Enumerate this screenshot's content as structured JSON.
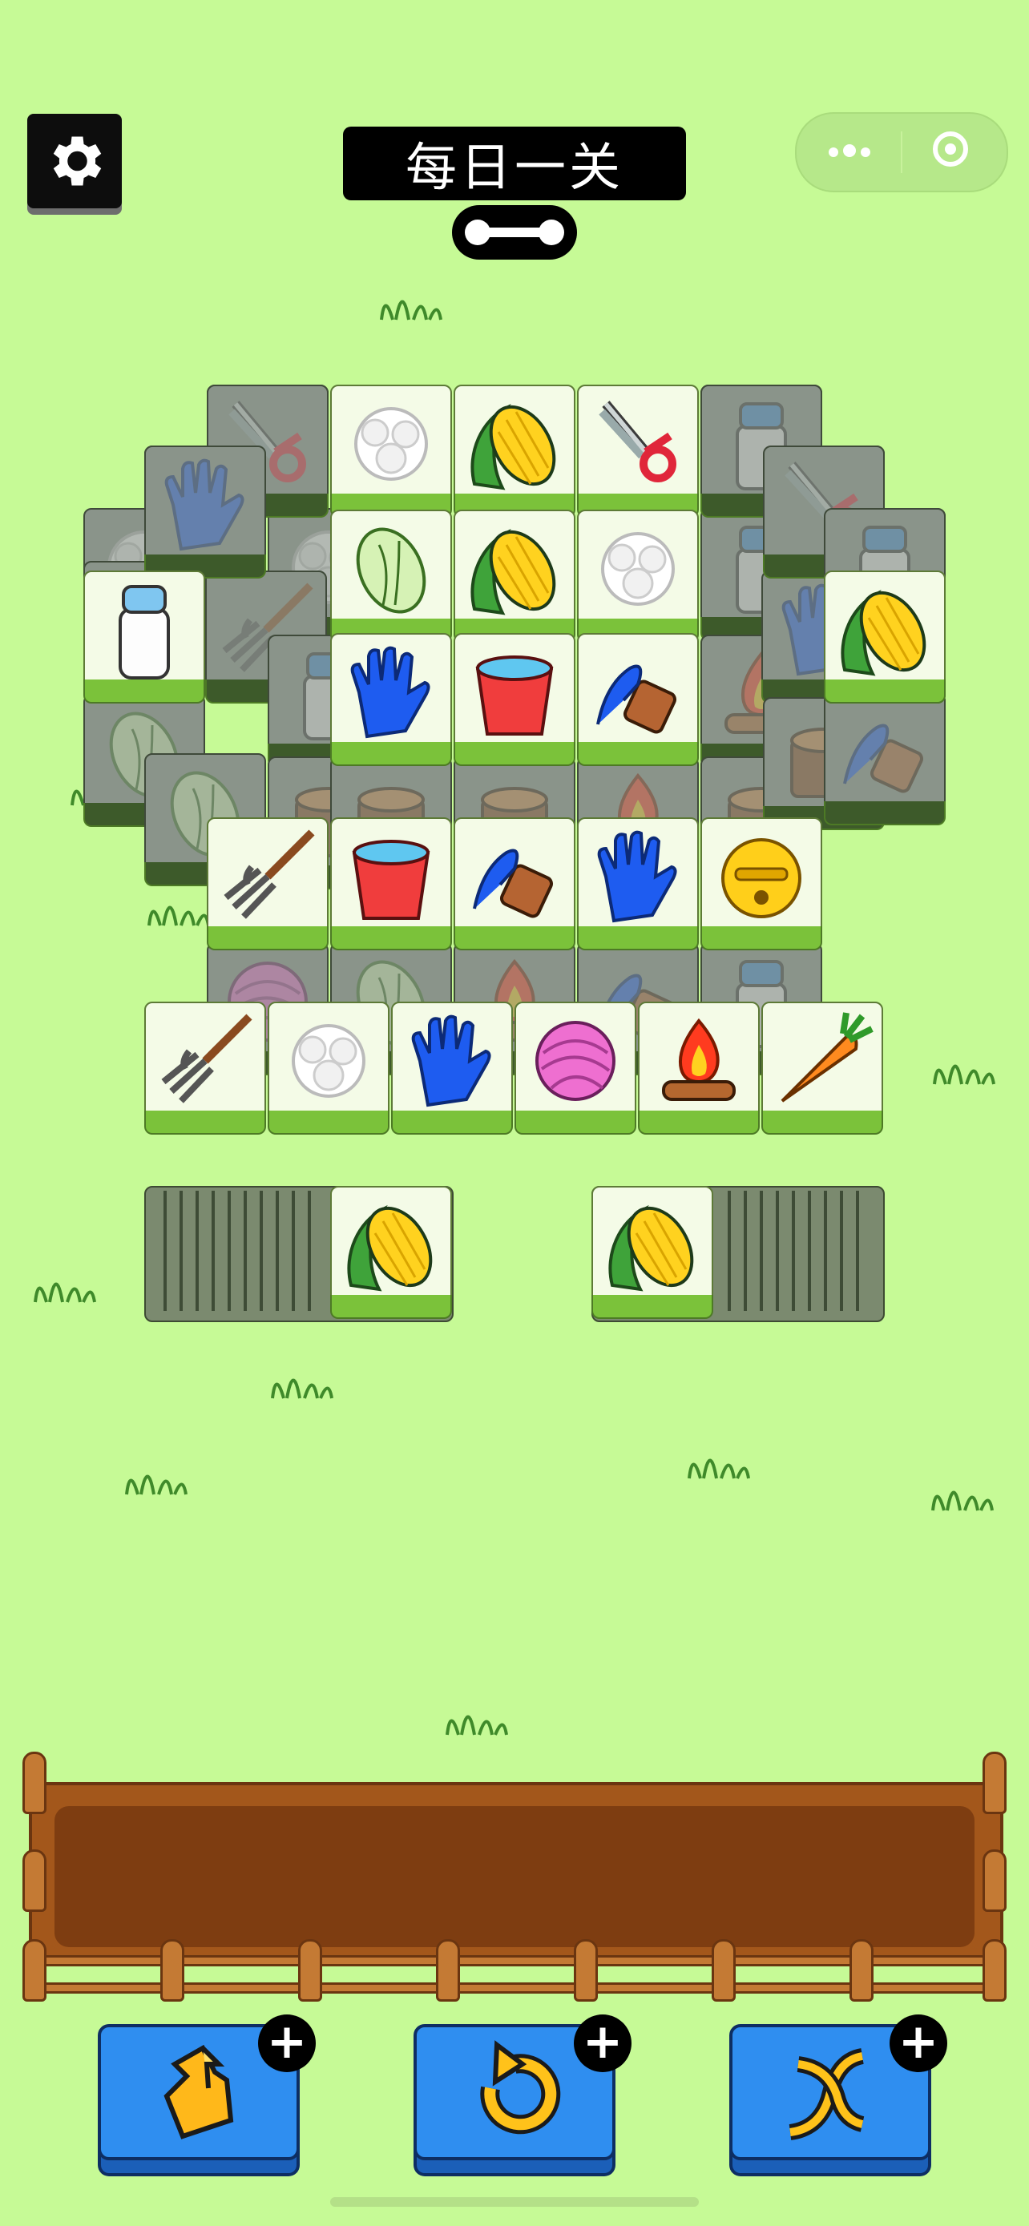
{
  "header": {
    "title": "每日一关",
    "settings_icon": "gear-icon",
    "capsule_icons": [
      "more-dots-icon",
      "target-circle-icon"
    ]
  },
  "board": {
    "top_tiles": [
      "scissors",
      "cotton",
      "corn",
      "scissors",
      "jar",
      "glove",
      "cabbage",
      "corn",
      "cotton",
      "glove",
      "bucket",
      "brush",
      "corn",
      "fork",
      "bucket",
      "brush",
      "glove",
      "bell",
      "fork",
      "cotton",
      "glove",
      "yarn",
      "campfire",
      "carrot",
      "milk"
    ],
    "left_pile_top": "corn",
    "right_pile_top": "corn"
  },
  "toolbar": {
    "buttons": [
      {
        "name": "move-out-button",
        "icon": "hand-up-icon",
        "badge": "+"
      },
      {
        "name": "undo-button",
        "icon": "undo-arrow-icon",
        "badge": "+"
      },
      {
        "name": "shuffle-button",
        "icon": "shuffle-arrows-icon",
        "badge": "+"
      }
    ]
  },
  "colors": {
    "background": "#c6fa96",
    "tile_face": "#f4fbe7",
    "tile_base": "#7bc23a",
    "button_blue": "#2f8ef0",
    "tray_wood": "#a3571b"
  }
}
